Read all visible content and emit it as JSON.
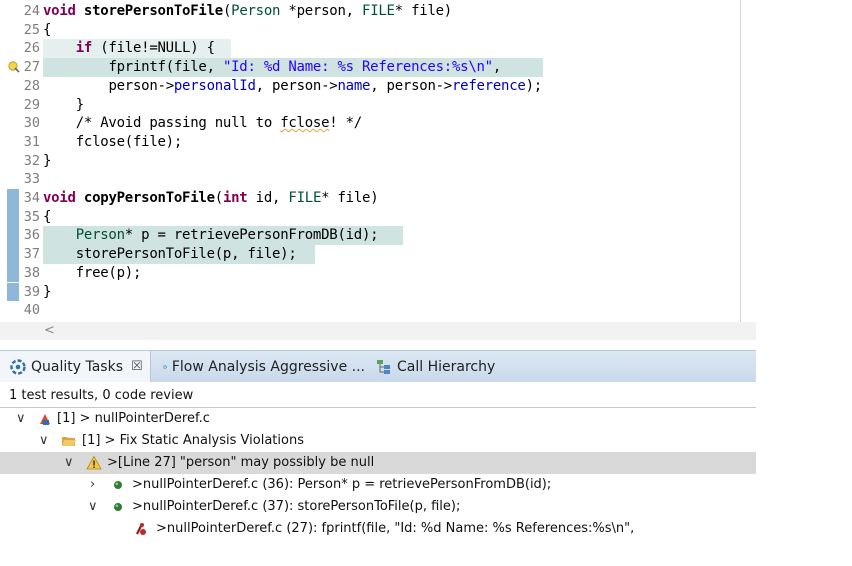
{
  "editor": {
    "lines": [
      {
        "n": "24",
        "fold": "",
        "html_id": "l24"
      },
      {
        "n": "25",
        "fold": "⊖"
      },
      {
        "n": "26"
      },
      {
        "n": "27"
      },
      {
        "n": "28"
      },
      {
        "n": "29"
      },
      {
        "n": "30"
      },
      {
        "n": "31"
      },
      {
        "n": "32"
      },
      {
        "n": "33"
      },
      {
        "n": "34"
      },
      {
        "n": "35"
      },
      {
        "n": "36"
      },
      {
        "n": "37"
      },
      {
        "n": "38"
      },
      {
        "n": "39"
      },
      {
        "n": "40"
      }
    ],
    "code": {
      "l24_kw": "void",
      "l24_fn": "storePersonToFile",
      "l24_rest1": "(",
      "l24_ty1": "Person",
      "l24_rest2": " *person, ",
      "l24_ty2": "FILE",
      "l24_rest3": "* file)",
      "l25": "{",
      "l26_kw": "if",
      "l26_rest": " (file!=NULL) {",
      "l27_pre": "fprintf(file, ",
      "l27_str": "\"Id: %d Name: %s References:%s\\n\"",
      "l27_post": ",",
      "l28_a": "person->",
      "l28_f1": "personalId",
      "l28_b": ", person->",
      "l28_f2": "name",
      "l28_c": ", person->",
      "l28_f3": "reference",
      "l28_d": ");",
      "l29": "}",
      "l30_a": "/* Avoid passing null to ",
      "l30_b": "fclose",
      "l30_c": "! */",
      "l31": "fclose(file);",
      "l32": "}",
      "l33": "",
      "l34_kw": "void",
      "l34_fn": "copyPersonToFile",
      "l34_a": "(",
      "l34_kw2": "int",
      "l34_b": " id, ",
      "l34_ty": "FILE",
      "l34_c": "* file)",
      "l35": "{",
      "l36_ty": "Person",
      "l36_rest": "* p = retrievePersonFromDB(id);",
      "l37": "storePersonToFile(p, file);",
      "l38": "free(p);",
      "l39": "}",
      "l40": ""
    }
  },
  "panel": {
    "tabs": [
      {
        "label": "Quality Tasks",
        "close": "☒"
      },
      {
        "label": "Flow Analysis Aggressive ..."
      },
      {
        "label": "Call Hierarchy"
      }
    ],
    "status": "1 test results, 0 code review",
    "tree": [
      {
        "label": "[1] > nullPointerDeref.c"
      },
      {
        "label": "[1] > Fix Static Analysis Violations"
      },
      {
        "label": ">[Line 27] \"person\" may possibly be null"
      },
      {
        "label": ">nullPointerDeref.c (36): Person* p = retrievePersonFromDB(id);"
      },
      {
        "label": ">nullPointerDeref.c (37): storePersonToFile(p, file);"
      },
      {
        "label": ">nullPointerDeref.c (27): fprintf(file, \"Id: %d Name: %s References:%s\\n\","
      }
    ],
    "twisties": {
      "expanded": "∨",
      "collapsed": "›"
    }
  },
  "colors": {
    "keyword": "#7f0055",
    "string": "#2a00ff",
    "comment": "#3f7f5f",
    "field": "#0000c0",
    "highlight": "#cfe3e0",
    "selection": "#d9d9d9"
  }
}
